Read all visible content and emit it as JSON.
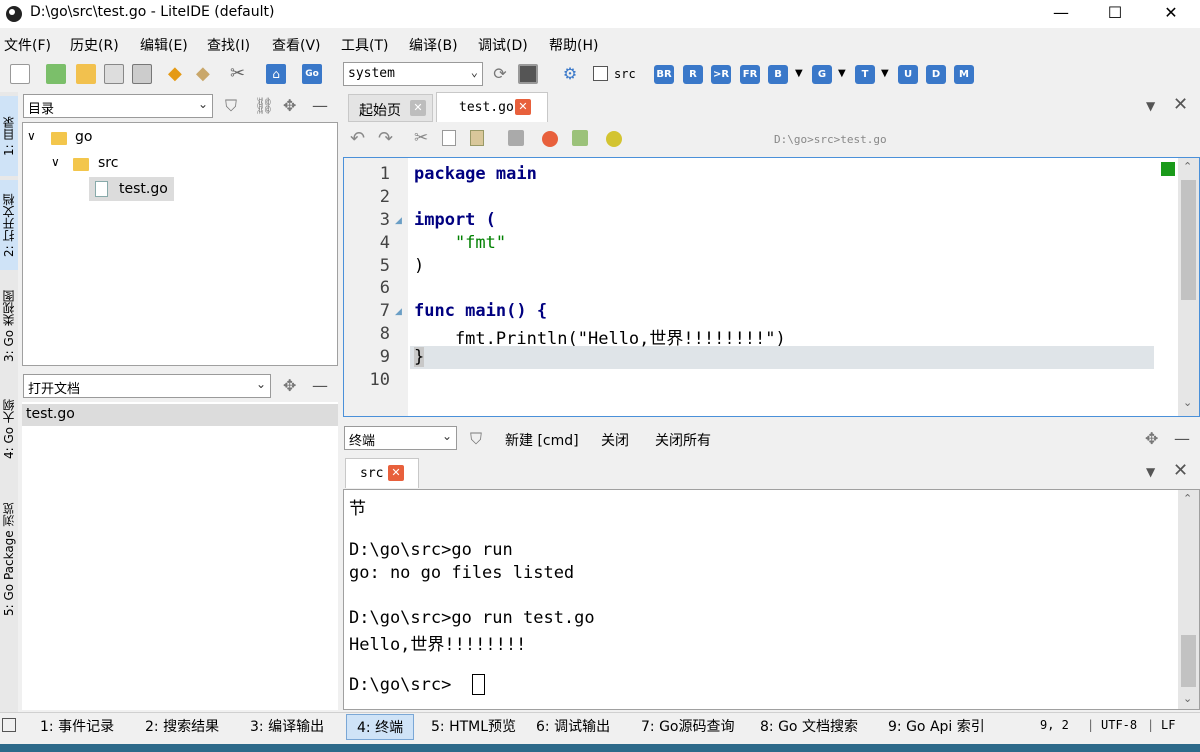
{
  "window": {
    "title": "D:\\go\\src\\test.go - LiteIDE (default)",
    "min": "—",
    "max": "☐",
    "close": "✕"
  },
  "menu": [
    "文件(F)",
    "历史(R)",
    "编辑(E)",
    "查找(I)",
    "查看(V)",
    "工具(T)",
    "编译(B)",
    "调试(D)",
    "帮助(H)"
  ],
  "toolbar": {
    "env_select": "system",
    "src_checkbox_label": "src",
    "build_buttons": [
      "BR",
      "R",
      ">R",
      "FR",
      "B",
      "G",
      "T",
      "U",
      "D",
      "M"
    ]
  },
  "left_vtabs": [
    "1: 目录",
    "2: 打开文档",
    "3: Go 类视图",
    "4: Go 大纲",
    "5: Go Package 浏览"
  ],
  "dir_panel": {
    "select": "目录",
    "tree": [
      {
        "label": "go",
        "type": "folder"
      },
      {
        "label": "src",
        "type": "folder"
      },
      {
        "label": "test.go",
        "type": "file"
      }
    ]
  },
  "open_docs": {
    "select": "打开文档",
    "items": [
      "test.go"
    ]
  },
  "editor": {
    "tabs": [
      {
        "label": "起始页"
      },
      {
        "label": "test.go"
      }
    ],
    "path": "D:\\go>src>test.go",
    "line_numbers": [
      "1",
      "2",
      "3",
      "4",
      "5",
      "6",
      "7",
      "8",
      "9",
      "10"
    ],
    "lines": [
      "package main",
      "",
      "import (",
      "    \"fmt\"",
      ")",
      "",
      "func main() {",
      "    fmt.Println(\"Hello,世界!!!!!!!!\")",
      "}",
      ""
    ]
  },
  "terminal": {
    "select": "终端",
    "actions": [
      "新建 [cmd]",
      "关闭",
      "关闭所有"
    ],
    "tab": "src",
    "lines": [
      "节",
      "",
      "D:\\go\\src>go run",
      "go: no go files listed",
      "",
      "D:\\go\\src>go run test.go",
      "Hello,世界!!!!!!!!",
      "",
      "D:\\go\\src>"
    ]
  },
  "bottom_tabs": [
    "1: 事件记录",
    "2: 搜索结果",
    "3: 编译输出",
    "4: 终端",
    "5: HTML预览",
    "6: 调试输出",
    "7: Go源码查询",
    "8: Go 文档搜索",
    "9: Go Api 索引"
  ],
  "status": {
    "position": "9, 2",
    "encoding": "UTF-8",
    "eol": "LF"
  },
  "colors": {
    "accent": "#3a78c9",
    "close_tab": "#e8603c",
    "active_tab": "#cfe3f7",
    "keyword": "#000080",
    "string": "#008000"
  }
}
